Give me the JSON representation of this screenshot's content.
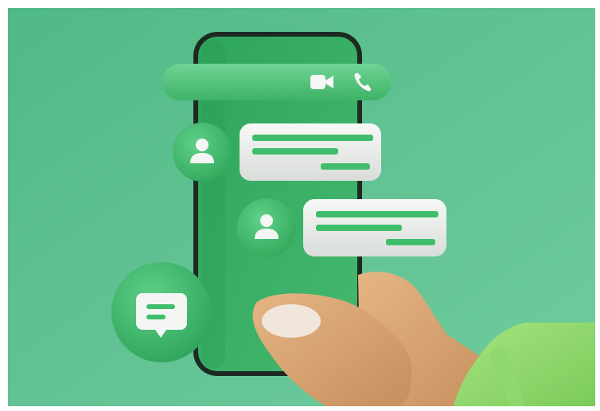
{
  "scene": {
    "description_colors": {
      "background": "#5fc08f",
      "background_light": "#73cba0",
      "phone_screen": "#3bb068",
      "bubble_white": "#eef0ee",
      "bar_green": "#3fbd6a",
      "accent_dark_green": "#2fa55a",
      "skin": "#d9a772",
      "sleeve": "#8fd86e"
    },
    "icons": {
      "video": "video-camera-icon",
      "call": "phone-handset-icon",
      "avatar": "user-silhouette-icon",
      "chat": "chat-bubble-icon"
    }
  }
}
